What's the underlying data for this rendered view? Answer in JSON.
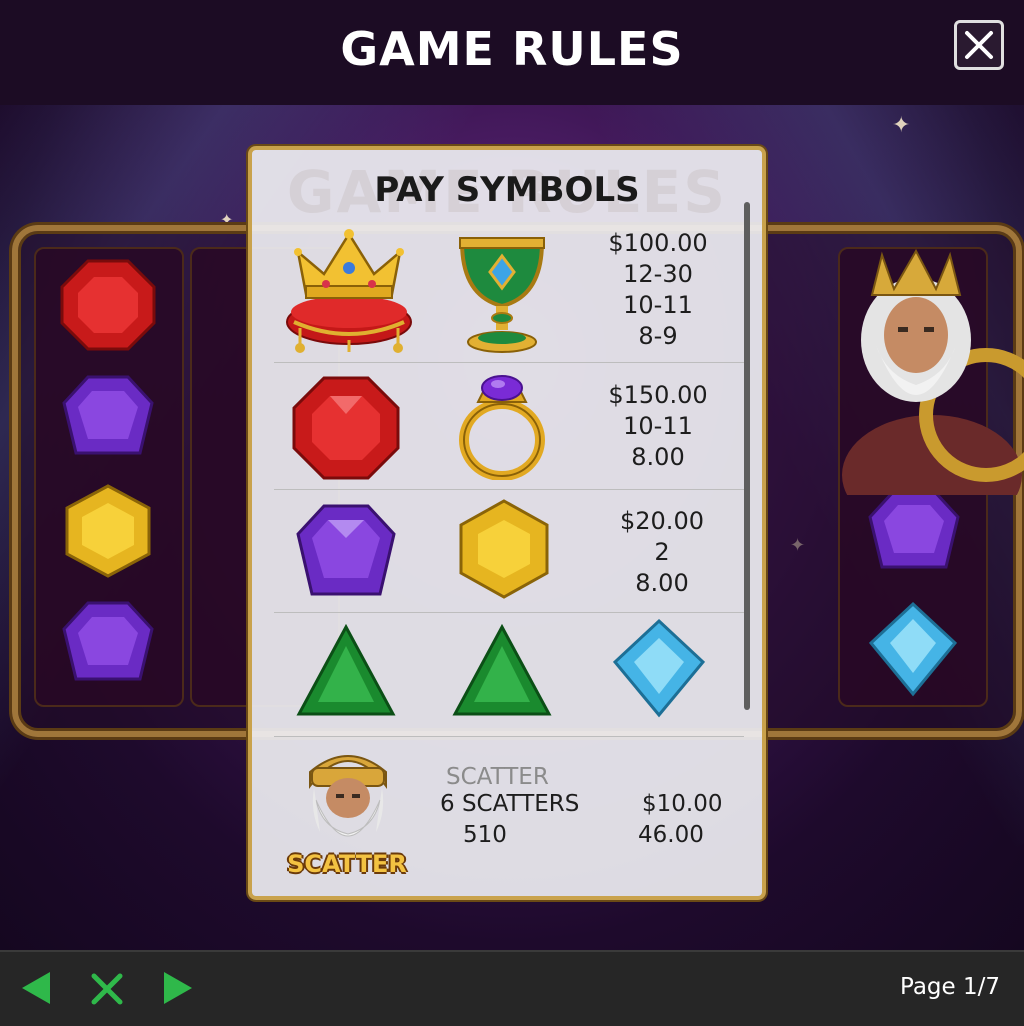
{
  "header": {
    "title": "GAME RULES",
    "close_icon": "close-icon"
  },
  "panel": {
    "title": "PAY SYMBOLS",
    "watermark": "GAME RULES",
    "rows": [
      {
        "symbols": [
          "crown-icon",
          "goblet-icon"
        ],
        "payouts": [
          "$100.00",
          "12-30",
          "10-11",
          "8-9"
        ]
      },
      {
        "symbols": [
          "red-gem-icon",
          "ring-icon"
        ],
        "payouts": [
          "$150.00",
          "10-11",
          "8.00"
        ]
      },
      {
        "symbols": [
          "purple-gem-icon",
          "yellow-gem-icon"
        ],
        "payouts": [
          "$20.00",
          "2",
          "8.00"
        ]
      },
      {
        "symbols": [
          "green-gem-icon",
          "green-gem-icon",
          "blue-gem-icon"
        ],
        "payouts": []
      }
    ],
    "scatter": {
      "symbol": "zeus-scatter-icon",
      "badge": "SCATTER",
      "label": "SCATTER",
      "count": "6 SCATTERS",
      "number": "510",
      "prize": "$10.00",
      "multiplier": "46.00"
    }
  },
  "footer": {
    "prev_icon": "arrow-left-icon",
    "close_icon": "close-x-icon",
    "next_icon": "arrow-right-icon",
    "page": "Page 1/7"
  },
  "colors": {
    "accent_green": "#2fb84a",
    "panel_border": "#c9a24c",
    "header_bg": "#1c0c24",
    "footer_bg": "#262626"
  }
}
